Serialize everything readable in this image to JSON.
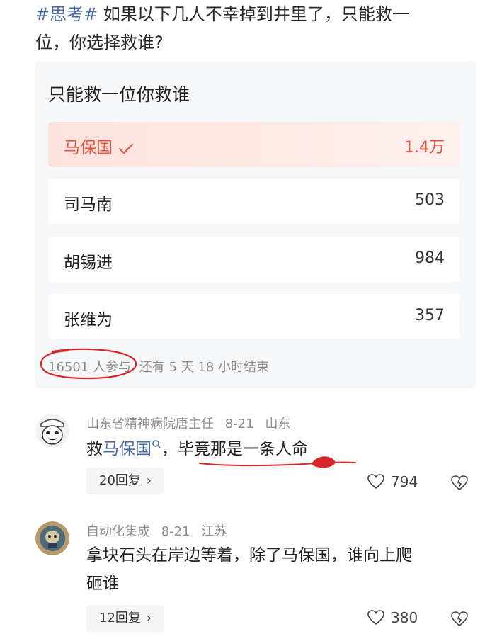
{
  "post": {
    "tag": "#思考#",
    "line1": " 如果以下几人不幸掉到井里了，只能救一",
    "line2": "位，你选择救谁?"
  },
  "poll": {
    "title": "只能救一位你救谁",
    "options": [
      {
        "label": "马保国",
        "count": "1.4万",
        "selected": true
      },
      {
        "label": "司马南",
        "count": "503",
        "selected": false
      },
      {
        "label": "胡锡进",
        "count": "984",
        "selected": false
      },
      {
        "label": "张维为",
        "count": "357",
        "selected": false
      }
    ],
    "participants": "16501 人参与",
    "remaining": "还有 5 天 18 小时结束"
  },
  "comments": [
    {
      "author": "山东省精神病院唐主任",
      "date": "8-21",
      "location": "山东",
      "text_prefix": "救",
      "text_link": "马保国",
      "text_suffix": "，毕竟那是一条人命",
      "replies": "20回复",
      "likes": "794",
      "avatar_icon": "meme-face-icon"
    },
    {
      "author": "自动化集成",
      "date": "8-21",
      "location": "江苏",
      "text_line1": "拿块石头在岸边等着，除了马保国，谁向上爬",
      "text_line2": "砸谁",
      "replies": "12回复",
      "likes": "380",
      "avatar_icon": "mascot-avatar-icon"
    }
  ],
  "colors": {
    "accent": "#e4553f",
    "link": "#4a6da7",
    "annotation_red": "#d6262a"
  }
}
